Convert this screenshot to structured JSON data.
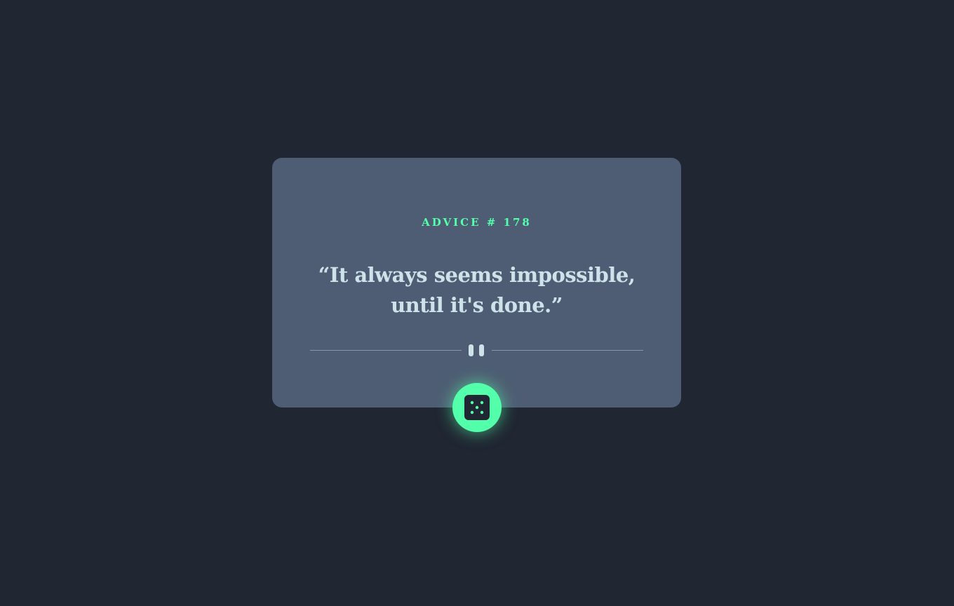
{
  "advice": {
    "id_label": "ADVICE # 178",
    "quote": "“It always seems impossible, until it's done.”"
  },
  "colors": {
    "background": "#202632",
    "card": "#4e5d73",
    "accent": "#53ffaa",
    "quote_text": "#cee3e9",
    "divider": "#8a97a8"
  },
  "icons": {
    "divider_center": "pause-icon",
    "generate_button": "dice-icon"
  }
}
